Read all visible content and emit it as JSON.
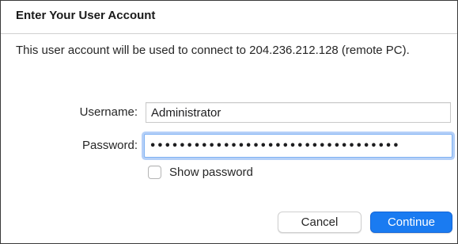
{
  "dialog": {
    "title": "Enter Your User Account",
    "message": "This user account will be used to connect to 204.236.212.128 (remote PC)."
  },
  "form": {
    "username_label": "Username:",
    "username_value": "Administrator",
    "password_label": "Password:",
    "password_value": "••••••••••••••••••••••••••••••••••",
    "show_password_label": "Show password",
    "show_password_checked": false
  },
  "buttons": {
    "cancel_label": "Cancel",
    "continue_label": "Continue"
  },
  "colors": {
    "accent": "#1a7bf1",
    "focus_ring": "#7fb2f3"
  }
}
